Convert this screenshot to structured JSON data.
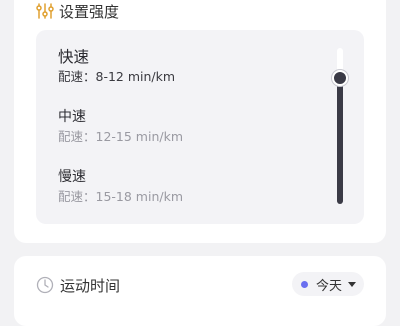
{
  "intensity": {
    "title": "设置强度",
    "icon": "tuning-icon",
    "options": [
      {
        "name": "快速",
        "pace": "配速：8-12 min/km",
        "selected": true
      },
      {
        "name": "中速",
        "pace": "配速：12-15 min/km",
        "selected": false
      },
      {
        "name": "慢速",
        "pace": "配速：15-18 min/km",
        "selected": false
      }
    ]
  },
  "sport_time": {
    "label": "运动时间",
    "icon": "clock-icon",
    "filter": {
      "value": "今天",
      "dot_color": "#6a6ff0"
    }
  },
  "colors": {
    "accent_dark": "#3a3a46",
    "panel_bg": "#f3f3f6"
  }
}
